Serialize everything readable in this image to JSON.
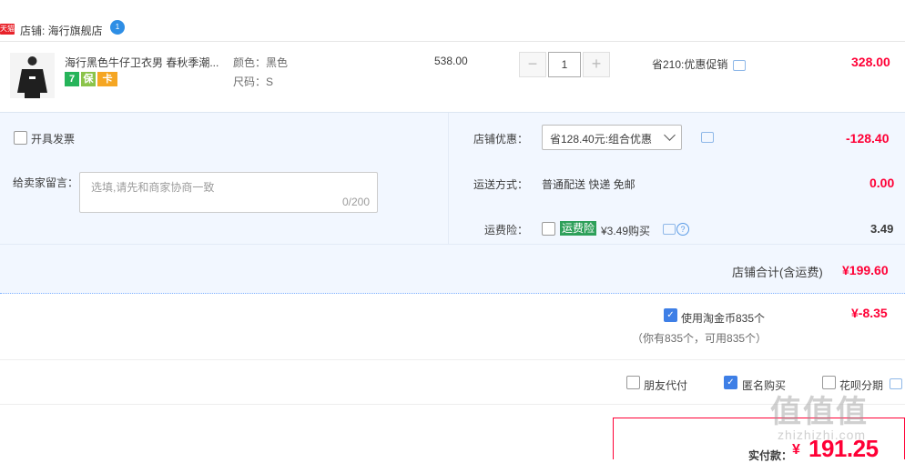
{
  "shop": {
    "badge": "天猫",
    "label": "店铺: 海行旗舰店",
    "ww_icon": "chat-bubble-icon"
  },
  "item": {
    "title": "海行黑色牛仔卫衣男 春秋季潮...",
    "service_icons": {
      "seven_day": "7",
      "guarantee": "保",
      "card": "卡"
    },
    "sku": [
      "颜色：黑色",
      "尺码：S"
    ],
    "unit_price": "538.00",
    "quantity": "1",
    "qty_minus": "−",
    "qty_plus": "+",
    "promo": "省210:优惠促销",
    "total": "328.00"
  },
  "order": {
    "invoice_label": "开具发票",
    "memo_label": "给卖家留言：",
    "memo_placeholder": "选填,请先和商家协商一致",
    "memo_count": "0/200",
    "discount_label": "店铺优惠：",
    "discount_selected": "省128.40元:组合优惠",
    "discount_amount": "-128.40",
    "shipping_label": "运送方式：",
    "shipping_value": "普通配送 快递 免邮",
    "shipping_amount": "0.00",
    "insurance_label": "运费险：",
    "insurance_tag": "运费险",
    "insurance_price": "¥3.49购买",
    "insurance_amount": "3.49",
    "subtotal_label": "店铺合计(含运费)",
    "subtotal_amount": "¥199.60"
  },
  "coins": {
    "checked": true,
    "label": "使用淘金币835个",
    "sub": "（你有835个，可用835个）",
    "amount": "¥-8.35"
  },
  "options": {
    "friend_pay": "朋友代付",
    "anonymous": "匿名购买",
    "anonymous_checked": true,
    "huabei": "花呗分期"
  },
  "payment": {
    "label": "实付款：",
    "currency": "¥",
    "amount": "191.25"
  },
  "watermark": {
    "text": "值值值",
    "sub": "zhizhizhi.com"
  },
  "colors": {
    "price_red": "#ff0036",
    "checkbox_blue": "#3e7fe6",
    "panel_bg": "#f2f7ff"
  }
}
